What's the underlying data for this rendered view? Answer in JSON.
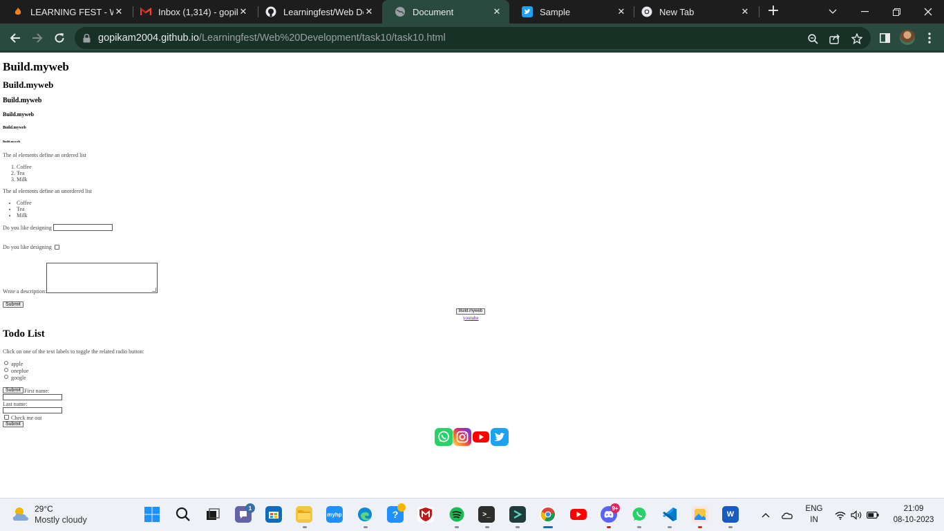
{
  "browser": {
    "tabs": [
      {
        "title": "LEARNING FEST - WE",
        "icon": "fire-icon",
        "active": false
      },
      {
        "title": "Inbox (1,314) - gopika",
        "icon": "gmail-icon",
        "active": false
      },
      {
        "title": "Learningfest/Web De",
        "icon": "github-icon",
        "active": false
      },
      {
        "title": "Document",
        "icon": "globe-icon",
        "active": true
      },
      {
        "title": "Sample",
        "icon": "twitter-icon",
        "active": false
      },
      {
        "title": "New Tab",
        "icon": "chrome-icon",
        "active": false
      }
    ],
    "url_host": "gopikam2004.github.io",
    "url_path": "/Learningfest/Web%20Development/task10/task10.html"
  },
  "page": {
    "headings": [
      "Build.myweb",
      "Build.myweb",
      "Build.myweb",
      "Build.myweb",
      "Build.myweb",
      "Build.myweb"
    ],
    "ol_caption": "The ol elements define an ordered list",
    "ol_items": [
      "Coffee",
      "Tea",
      "Milk"
    ],
    "ul_caption": "The ul elements define an unordered list",
    "ul_items": [
      "Coffee",
      "Tea",
      "Milk"
    ],
    "text_question": "Do you like designing",
    "checkbox_question": "Do you like designing",
    "description_label": "Write a description:",
    "submit_label": "Submit",
    "center_button": "Build.myweb",
    "youtube_link": "youtube",
    "todo_title": "Todo List",
    "radio_hint": "Click on one of the text labels to toggle the related radio button:",
    "radio_options": [
      "apple",
      "oneplue",
      "google"
    ],
    "form_submit": "Submit",
    "first_name_label": "First name:",
    "last_name_label": "Last name:",
    "check_me_out": "Check me out",
    "form_submit_2": "Submit",
    "social_icons": [
      "whatsapp-icon",
      "instagram-icon",
      "youtube-icon",
      "twitter-icon"
    ]
  },
  "taskbar": {
    "weather_temp": "29°C",
    "weather_desc": "Mostly cloudy",
    "chat_badge": "1",
    "discord_badge": "9+",
    "lang_top": "ENG",
    "lang_bottom": "IN",
    "time": "21:09",
    "date": "08-10-2023"
  },
  "colors": {
    "toolbar": "#2a4a3f",
    "tabstrip": "#1d1d1d",
    "taskbar": "#eef1f6",
    "whatsapp": "#25d366",
    "youtube": "#ff0000",
    "twitter": "#1da1f2"
  }
}
